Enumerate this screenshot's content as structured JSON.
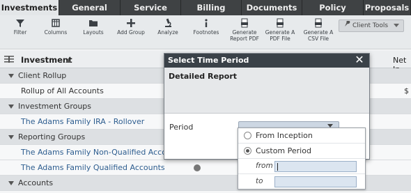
{
  "tabs": [
    {
      "label": "Investments",
      "active": true
    },
    {
      "label": "General",
      "active": false
    },
    {
      "label": "Service",
      "active": false
    },
    {
      "label": "Billing",
      "active": false
    },
    {
      "label": "Documents",
      "active": false
    },
    {
      "label": "Policy",
      "active": false
    },
    {
      "label": "Proposals",
      "active": false
    }
  ],
  "toolbar": {
    "filter": "Filter",
    "columns": "Columns",
    "layouts": "Layouts",
    "add_group": "Add Group",
    "analyze": "Analyze",
    "footnotes": "Footnotes",
    "gen_pdf_line1": "Generate",
    "gen_pdf_line2": "Report PDF",
    "gen_a_pdf_line1": "Generate A",
    "gen_a_pdf_line2": "PDF File",
    "gen_csv_line1": "Generate A",
    "gen_csv_line2": "CSV File",
    "client_tools": "Client Tools"
  },
  "grid": {
    "column_title": "Investment",
    "right_column": "Net In",
    "rows": [
      {
        "type": "group",
        "label": "Client Rollup"
      },
      {
        "type": "item",
        "label": "Rollup of All Accounts",
        "value": "$"
      },
      {
        "type": "group",
        "label": "Investment Groups"
      },
      {
        "type": "item",
        "label": "The Adams Family IRA - Rollover",
        "link": true
      },
      {
        "type": "group",
        "label": "Reporting Groups"
      },
      {
        "type": "item",
        "label": "The Adams Family Non-Qualified Accounts",
        "link": true
      },
      {
        "type": "item",
        "label": "The Adams Family Qualified Accounts",
        "link": true
      },
      {
        "type": "group",
        "label": "Accounts"
      }
    ]
  },
  "modal": {
    "title": "Select Time Period",
    "subtitle": "Detailed Report",
    "period_label": "Period",
    "options": [
      {
        "label": "From Inception",
        "selected": false
      },
      {
        "label": "Custom Period",
        "selected": true
      }
    ],
    "from_label": "from",
    "to_label": "to",
    "from_value": "",
    "to_value": ""
  }
}
